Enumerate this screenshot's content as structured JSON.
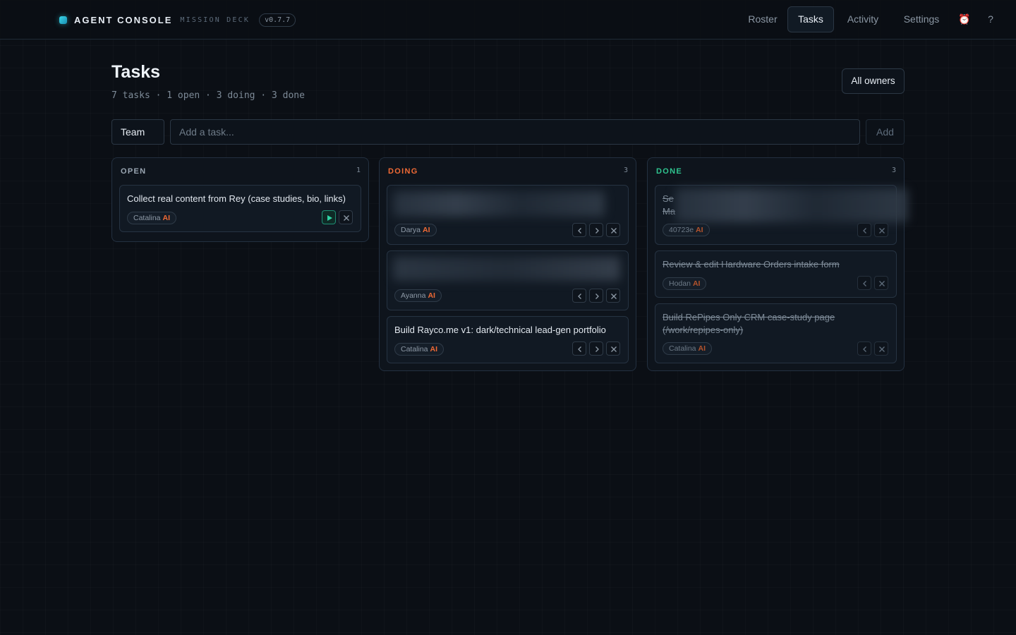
{
  "app": {
    "name": "AGENT CONSOLE",
    "subtitle": "MISSION DECK",
    "version": "v0.7.7"
  },
  "nav": {
    "items": [
      {
        "label": "Roster"
      },
      {
        "label": "Tasks"
      },
      {
        "label": "Activity"
      },
      {
        "label": "Settings"
      }
    ],
    "alarm_icon": "⏰",
    "help_icon": "?"
  },
  "page": {
    "title": "Tasks",
    "summary": "7 tasks · 1 open · 3 doing · 3 done",
    "owner_filter": "All owners"
  },
  "composer": {
    "team_label": "Team",
    "placeholder": "Add a task...",
    "add_label": "Add"
  },
  "ai_tag": "AI",
  "colors": {
    "open": "#9aa6b2",
    "doing": "#f06a35",
    "done": "#2fc48f",
    "accent": "#3ad6e8"
  },
  "columns": {
    "open": {
      "label": "OPEN",
      "count": "1",
      "cards": [
        {
          "title": "Collect real content from Rey (case studies, bio, links)",
          "owner": "Catalina"
        }
      ]
    },
    "doing": {
      "label": "DOING",
      "count": "3",
      "cards": [
        {
          "title": "",
          "owner": "Darya"
        },
        {
          "title": "",
          "owner": "Ayanna"
        },
        {
          "title": "Build Rayco.me v1: dark/technical lead-gen portfolio",
          "owner": "Catalina"
        }
      ]
    },
    "done": {
      "label": "DONE",
      "count": "3",
      "cards": [
        {
          "title_fragment_1": "Se",
          "title_fragment_2": "Ma",
          "owner": "40723e"
        },
        {
          "title": "Review & edit Hardware Orders intake form",
          "owner": "Hodan"
        },
        {
          "title": "Build RePipes Only CRM case-study page (/work/repipes-only)",
          "owner": "Catalina"
        }
      ]
    }
  }
}
